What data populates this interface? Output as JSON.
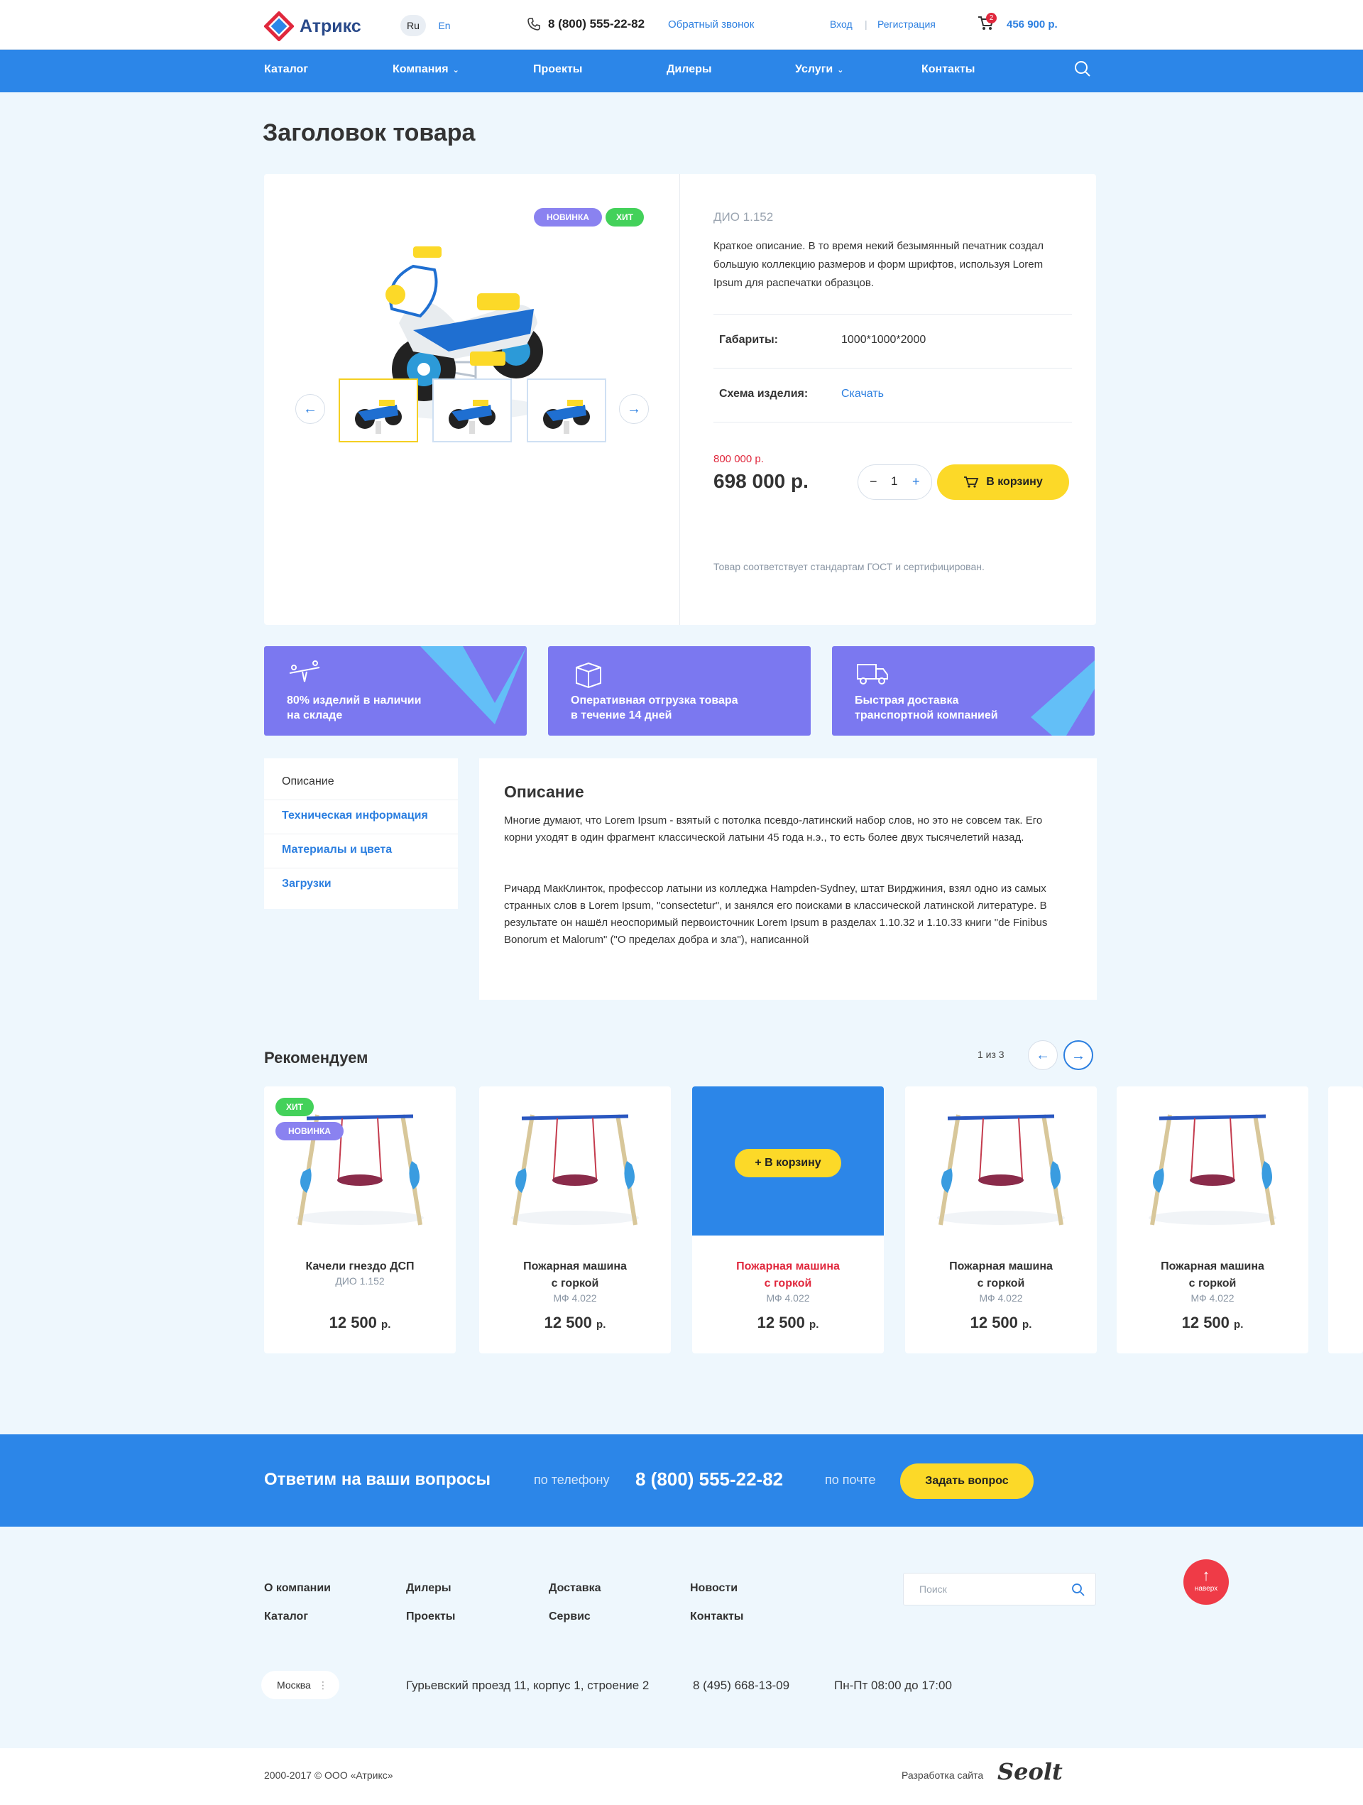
{
  "header": {
    "logo_text": "Атрикс",
    "langs": [
      "Ru",
      "En"
    ],
    "phone": "8 (800) 555-22-82",
    "callback": "Обратный звонок",
    "login": "Вход",
    "separator": "|",
    "register": "Регистрация",
    "cart_count": "2",
    "cart_sum": "456 900 р."
  },
  "nav": {
    "items": [
      "Каталог",
      "Компания",
      "Проекты",
      "Дилеры",
      "Услуги",
      "Контакты"
    ]
  },
  "page_title": "Заголовок товара",
  "product": {
    "badges": [
      "НОВИНКА",
      "ХИТ"
    ],
    "sku": "ДИО 1.152",
    "short_desc": "Краткое описание. В то время некий безымянный печатник создал большую коллекцию размеров и форм шрифтов, используя Lorem Ipsum для распечатки образцов.",
    "specs": [
      {
        "label": "Габариты:",
        "value": "1000*1000*2000"
      },
      {
        "label": "Схема изделия:",
        "value": "Скачать"
      }
    ],
    "old_price": "800 000 р.",
    "price": "698 000 р.",
    "qty": "1",
    "qty_minus": "−",
    "qty_plus": "+",
    "cart_button": "В корзину",
    "gost": "Товар соответствует стандартам ГОСТ и сертифицирован."
  },
  "features": [
    {
      "line1": "80% изделий в наличии",
      "line2": "на складе"
    },
    {
      "line1": "Оперативная отгрузка товара",
      "line2": "в течение 14 дней"
    },
    {
      "line1": "Быстрая доставка",
      "line2": "транспортной компанией"
    }
  ],
  "tabs": [
    "Описание",
    "Техническая информация",
    "Материалы и цвета",
    "Загрузки"
  ],
  "description": {
    "title": "Описание",
    "p1": "Многие думают, что Lorem Ipsum - взятый с потолка псевдо-латинский набор слов, но это не совсем так. Его корни уходят в один фрагмент классической латыни 45 года н.э., то есть более двух тысячелетий назад.",
    "p2": "Ричард МакКлинток, профессор латыни из колледжа Hampden-Sydney, штат Вирджиния, взял одно из самых странных слов в Lorem Ipsum, \"consectetur\", и занялся его поисками в классической латинской литературе. В результате он нашёл неоспоримый первоисточник Lorem Ipsum в разделах 1.10.32 и 1.10.33 книги \"de Finibus Bonorum et Malorum\" (\"О пределах добра и зла\"), написанной"
  },
  "recommend": {
    "title": "Рекомендуем",
    "pager": "1 из 3",
    "hover_button": "+ В корзину",
    "currency": "р.",
    "items": [
      {
        "name1": "Качели гнездо ДСП",
        "name2": "",
        "sku": "ДИО 1.152",
        "price": "12 500",
        "badges": [
          "ХИТ",
          "НОВИНКА"
        ]
      },
      {
        "name1": "Пожарная машина",
        "name2": "с горкой",
        "sku": "МФ 4.022",
        "price": "12 500",
        "badges": []
      },
      {
        "name1": "Пожарная машина",
        "name2": "с горкой",
        "sku": "МФ 4.022",
        "price": "12 500",
        "badges": []
      },
      {
        "name1": "Пожарная машина",
        "name2": "с горкой",
        "sku": "МФ 4.022",
        "price": "12 500",
        "badges": []
      },
      {
        "name1": "Пожарная машина",
        "name2": "с горкой",
        "sku": "МФ 4.022",
        "price": "12 500",
        "badges": []
      }
    ]
  },
  "cta": {
    "title": "Ответим на ваши вопросы",
    "by_phone": "по телефону",
    "phone": "8 (800) 555-22-82",
    "by_mail": "по почте",
    "button": "Задать вопрос"
  },
  "footer": {
    "links": [
      [
        "О компании",
        "Каталог"
      ],
      [
        "Дилеры",
        "Проекты"
      ],
      [
        "Доставка",
        "Сервис"
      ],
      [
        "Новости",
        "Контакты"
      ]
    ],
    "search_placeholder": "Поиск",
    "up_label": "наверх",
    "city": "Москва",
    "address": "Гурьевский проезд 11, корпус 1, строение 2",
    "phone": "8 (495) 668-13-09",
    "hours": "Пн-Пт 08:00 до 17:00",
    "copyright": "2000-2017 © ООО «Атрикс»",
    "dev_label": "Разработка сайта",
    "dev_logo": "Seolt"
  },
  "colors": {
    "accent": "#2c86e8",
    "yellow": "#fcd928",
    "feature": "#7b78f0",
    "red": "#e0283d"
  }
}
